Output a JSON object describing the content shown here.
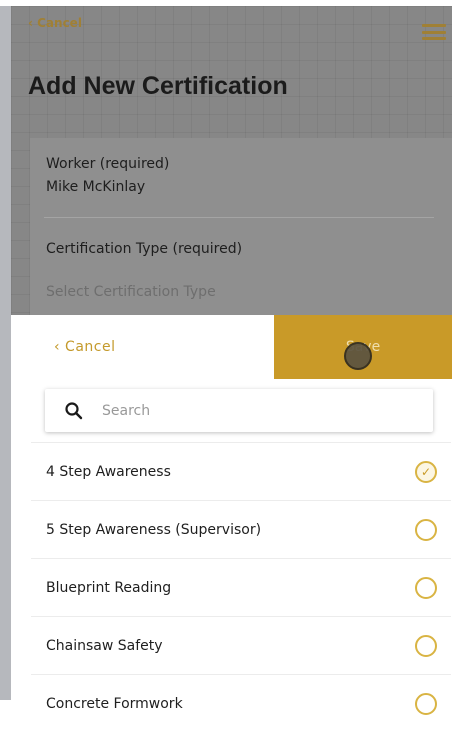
{
  "background_page": {
    "cancel_label": "‹ Cancel",
    "title": "Add New Certification",
    "worker_label": "Worker (required)",
    "worker_value": "Mike McKinlay",
    "cert_type_label": "Certification Type (required)",
    "cert_type_placeholder": "Select Certification Type"
  },
  "sheet": {
    "cancel_label": "‹ Cancel",
    "save_label": "Save",
    "search_placeholder": "Search",
    "items": [
      {
        "label": "4 Step Awareness",
        "selected": true
      },
      {
        "label": "5 Step Awareness (Supervisor)",
        "selected": false
      },
      {
        "label": "Blueprint Reading",
        "selected": false
      },
      {
        "label": "Chainsaw Safety",
        "selected": false
      },
      {
        "label": "Concrete Formwork",
        "selected": false
      }
    ]
  },
  "colors": {
    "accent": "#c99a28",
    "overlay": "#878787"
  }
}
